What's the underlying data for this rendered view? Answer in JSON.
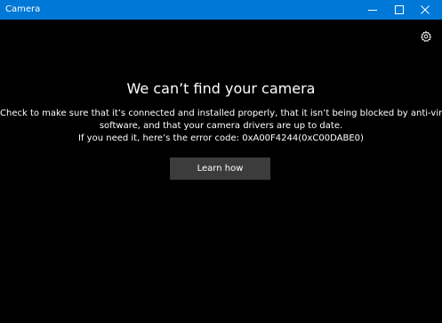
{
  "window": {
    "title": "Camera",
    "accent_color": "#0078d7",
    "background_color": "#000000",
    "controls": {
      "minimize_icon": "minimize-icon",
      "maximize_icon": "maximize-icon",
      "close_icon": "close-icon"
    }
  },
  "toolbar": {
    "settings_icon": "gear-icon"
  },
  "error": {
    "heading": "We can’t find your camera",
    "lines": [
      "Check to make sure that it’s connected and installed properly, that it isn’t being blocked by anti-virus",
      "software, and that your camera drivers are up to date.",
      "If you need it, here’s the error code: 0xA00F4244(0xC00DABE0)"
    ],
    "button_label": "Learn how",
    "button_color": "#3c3c3c"
  }
}
